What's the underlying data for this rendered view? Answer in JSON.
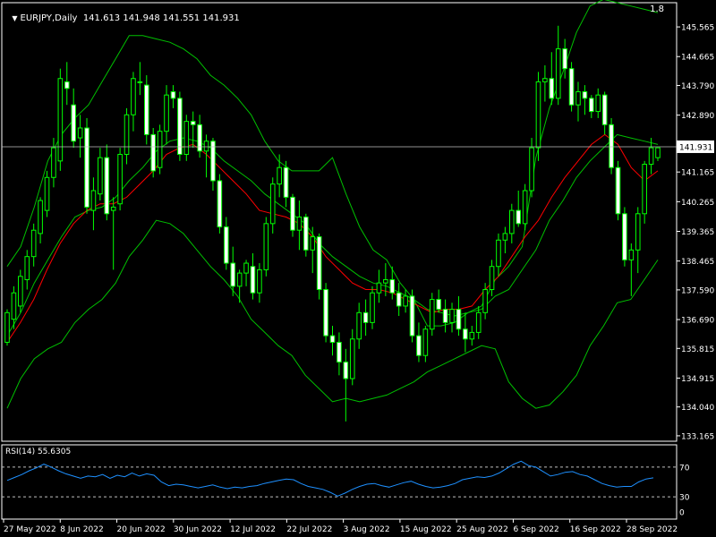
{
  "header": {
    "symbol_tf": "EURJPY,Daily",
    "ohlc": "141.613 141.948 141.551 141.931",
    "scale_number": "1.8"
  },
  "rsi": {
    "label": "RSI(14) 55.6305",
    "levels": [
      "70",
      "30",
      "0"
    ],
    "upper": 70,
    "lower": 30
  },
  "current_price": "141.931",
  "colors": {
    "background": "#000000",
    "bull_body": "#000000",
    "bear_body": "#ffffff",
    "candle_wick": "#00ff00",
    "bollinger": "#00c000",
    "ma": "#ff0000",
    "rsi": "#1e90ff",
    "axis": "#ffffff",
    "price_line": "#c0c0c0"
  },
  "chart_data": [
    {
      "type": "candlestick",
      "title": "EURJPY,Daily",
      "y_ticks": [
        "145.565",
        "144.665",
        "143.790",
        "142.890",
        "141.931",
        "141.165",
        "140.265",
        "139.365",
        "138.465",
        "137.590",
        "136.690",
        "135.815",
        "134.915",
        "134.040",
        "133.165"
      ],
      "x_ticks": [
        "27 May 2022",
        "8 Jun 2022",
        "20 Jun 2022",
        "30 Jun 2022",
        "12 Jul 2022",
        "22 Jul 2022",
        "3 Aug 2022",
        "15 Aug 2022",
        "25 Aug 2022",
        "6 Sep 2022",
        "16 Sep 2022",
        "28 Sep 2022"
      ],
      "ylim": [
        133.0,
        146.3
      ],
      "candles": [
        [
          136.0,
          137.0,
          135.9,
          136.9
        ],
        [
          136.7,
          137.7,
          136.4,
          137.5
        ],
        [
          137.1,
          138.2,
          136.9,
          138.0
        ],
        [
          137.9,
          138.8,
          137.6,
          138.6
        ],
        [
          138.6,
          139.6,
          138.3,
          139.4
        ],
        [
          139.3,
          140.4,
          139.0,
          140.3
        ],
        [
          140.0,
          141.2,
          139.8,
          141.0
        ],
        [
          141.0,
          142.2,
          140.7,
          141.9
        ],
        [
          141.5,
          144.3,
          141.2,
          144.0
        ],
        [
          143.9,
          144.5,
          143.2,
          143.7
        ],
        [
          143.2,
          143.7,
          141.9,
          142.1
        ],
        [
          142.2,
          142.9,
          141.6,
          142.5
        ],
        [
          142.5,
          142.8,
          139.9,
          140.1
        ],
        [
          140.0,
          141.0,
          139.4,
          140.6
        ],
        [
          140.5,
          141.9,
          140.3,
          141.6
        ],
        [
          141.6,
          142.0,
          139.7,
          139.9
        ],
        [
          140.0,
          140.4,
          138.2,
          140.1
        ],
        [
          140.2,
          141.9,
          140.0,
          141.7
        ],
        [
          141.7,
          143.1,
          141.4,
          142.9
        ],
        [
          142.9,
          144.2,
          142.4,
          144.0
        ],
        [
          143.9,
          144.5,
          143.5,
          143.9
        ],
        [
          143.8,
          144.1,
          142.0,
          142.3
        ],
        [
          142.3,
          142.5,
          141.0,
          141.2
        ],
        [
          141.3,
          142.6,
          141.1,
          142.4
        ],
        [
          142.4,
          143.8,
          142.0,
          143.5
        ],
        [
          143.6,
          143.8,
          143.1,
          143.4
        ],
        [
          143.4,
          143.6,
          141.5,
          141.7
        ],
        [
          141.7,
          142.9,
          141.5,
          142.7
        ],
        [
          142.7,
          143.0,
          141.9,
          142.6
        ],
        [
          142.6,
          142.9,
          141.6,
          141.8
        ],
        [
          141.8,
          142.3,
          141.0,
          142.1
        ],
        [
          142.1,
          142.2,
          140.6,
          140.9
        ],
        [
          140.9,
          141.1,
          139.3,
          139.5
        ],
        [
          139.5,
          139.8,
          138.2,
          138.4
        ],
        [
          138.4,
          138.9,
          137.4,
          137.7
        ],
        [
          137.7,
          138.2,
          137.2,
          138.1
        ],
        [
          138.1,
          138.5,
          137.7,
          138.4
        ],
        [
          138.3,
          138.7,
          137.3,
          137.5
        ],
        [
          137.5,
          138.4,
          137.2,
          138.2
        ],
        [
          138.2,
          139.8,
          138.0,
          139.6
        ],
        [
          139.6,
          141.0,
          139.3,
          140.8
        ],
        [
          140.8,
          141.7,
          140.4,
          141.3
        ],
        [
          141.3,
          141.5,
          140.1,
          140.4
        ],
        [
          140.4,
          140.5,
          139.2,
          139.4
        ],
        [
          139.4,
          140.3,
          138.8,
          139.8
        ],
        [
          139.8,
          139.9,
          138.6,
          138.8
        ],
        [
          138.8,
          139.5,
          138.1,
          139.2
        ],
        [
          139.2,
          139.3,
          137.3,
          137.6
        ],
        [
          137.6,
          137.8,
          136.0,
          136.2
        ],
        [
          136.2,
          136.5,
          135.6,
          136.0
        ],
        [
          136.0,
          136.3,
          135.0,
          135.4
        ],
        [
          135.4,
          135.8,
          133.6,
          134.9
        ],
        [
          134.9,
          136.4,
          134.7,
          136.1
        ],
        [
          136.1,
          137.2,
          135.8,
          136.9
        ],
        [
          136.9,
          137.3,
          136.2,
          136.6
        ],
        [
          136.6,
          137.7,
          136.4,
          137.5
        ],
        [
          137.5,
          138.2,
          137.2,
          137.8
        ],
        [
          137.8,
          138.4,
          137.4,
          137.9
        ],
        [
          137.9,
          138.3,
          137.3,
          137.5
        ],
        [
          137.5,
          137.8,
          136.8,
          137.1
        ],
        [
          137.1,
          137.6,
          136.9,
          137.4
        ],
        [
          137.4,
          137.6,
          136.0,
          136.2
        ],
        [
          136.2,
          136.6,
          135.4,
          135.6
        ],
        [
          135.6,
          136.5,
          135.4,
          136.4
        ],
        [
          136.4,
          137.5,
          136.2,
          137.3
        ],
        [
          137.3,
          137.6,
          136.9,
          137.0
        ],
        [
          137.0,
          137.3,
          136.3,
          136.6
        ],
        [
          136.6,
          137.2,
          136.3,
          137.0
        ],
        [
          137.0,
          137.4,
          136.2,
          136.4
        ],
        [
          136.4,
          136.9,
          135.7,
          136.1
        ],
        [
          136.1,
          136.5,
          135.9,
          136.3
        ],
        [
          136.3,
          137.1,
          136.1,
          136.9
        ],
        [
          136.9,
          137.8,
          136.7,
          137.6
        ],
        [
          137.6,
          138.5,
          137.4,
          138.3
        ],
        [
          138.3,
          139.3,
          138.0,
          139.1
        ],
        [
          139.1,
          139.5,
          138.7,
          139.3
        ],
        [
          139.3,
          140.2,
          139.0,
          140.0
        ],
        [
          140.0,
          140.6,
          139.5,
          139.6
        ],
        [
          139.6,
          140.8,
          139.4,
          140.6
        ],
        [
          140.6,
          142.2,
          140.4,
          141.9
        ],
        [
          141.9,
          144.2,
          141.5,
          143.9
        ],
        [
          143.9,
          144.4,
          143.3,
          144.0
        ],
        [
          144.0,
          144.8,
          143.2,
          143.4
        ],
        [
          143.4,
          145.6,
          143.2,
          144.9
        ],
        [
          144.9,
          145.2,
          144.0,
          144.3
        ],
        [
          144.3,
          144.5,
          143.0,
          143.2
        ],
        [
          143.2,
          143.9,
          142.7,
          143.6
        ],
        [
          143.6,
          143.8,
          142.9,
          143.4
        ],
        [
          143.4,
          143.5,
          142.8,
          143.0
        ],
        [
          143.0,
          143.7,
          142.8,
          143.5
        ],
        [
          143.5,
          143.6,
          142.3,
          142.6
        ],
        [
          142.6,
          142.8,
          141.1,
          141.3
        ],
        [
          141.3,
          141.5,
          139.7,
          139.9
        ],
        [
          139.9,
          140.1,
          138.3,
          138.5
        ],
        [
          138.5,
          139.0,
          137.4,
          138.8
        ],
        [
          138.8,
          140.1,
          138.1,
          139.9
        ],
        [
          139.9,
          141.5,
          139.6,
          141.4
        ],
        [
          141.4,
          142.2,
          141.1,
          141.9
        ],
        [
          141.6,
          141.9,
          141.5,
          141.9
        ]
      ],
      "bb_upper": [
        138.3,
        138.9,
        140.1,
        141.5,
        142.3,
        142.8,
        143.2,
        143.9,
        144.6,
        145.3,
        145.3,
        145.2,
        145.1,
        144.9,
        144.6,
        144.1,
        143.8,
        143.4,
        142.9,
        142.1,
        141.5,
        141.2,
        141.2,
        141.2,
        141.6,
        140.5,
        139.5,
        138.8,
        138.5,
        137.8,
        137.3,
        136.5,
        136.5,
        136.6,
        136.9,
        137.1,
        137.9,
        138.3,
        138.9,
        141.6,
        143.1,
        144.2,
        145.4,
        146.2,
        146.4,
        146.3,
        146.2,
        146.1,
        146.0
      ],
      "bb_mid": [
        136.2,
        136.9,
        137.8,
        138.5,
        139.2,
        139.8,
        140.0,
        140.1,
        140.4,
        140.9,
        141.3,
        141.8,
        142.1,
        142.2,
        142.1,
        141.9,
        141.5,
        141.2,
        140.9,
        140.5,
        140.2,
        139.9,
        139.6,
        139.0,
        138.6,
        138.3,
        138.0,
        137.8,
        137.7,
        137.5,
        137.3,
        137.0,
        136.9,
        136.8,
        136.9,
        137.0,
        137.4,
        137.6,
        138.2,
        138.8,
        139.7,
        140.3,
        141.0,
        141.5,
        141.9,
        142.3,
        142.2,
        142.1,
        142.0
      ],
      "bb_lower": [
        134.0,
        134.9,
        135.5,
        135.8,
        136.0,
        136.6,
        137.0,
        137.3,
        137.8,
        138.6,
        139.1,
        139.7,
        139.6,
        139.3,
        138.8,
        138.3,
        137.9,
        137.4,
        136.7,
        136.3,
        135.9,
        135.6,
        135.0,
        134.6,
        134.2,
        134.3,
        134.2,
        134.3,
        134.4,
        134.6,
        134.8,
        135.1,
        135.3,
        135.5,
        135.7,
        135.9,
        135.8,
        134.8,
        134.3,
        134.0,
        134.1,
        134.5,
        135.0,
        135.9,
        136.5,
        137.2,
        137.3,
        137.9,
        138.5
      ],
      "ma": [
        136.0,
        136.6,
        137.3,
        138.2,
        139.0,
        139.6,
        140.0,
        140.2,
        140.2,
        140.4,
        140.8,
        141.2,
        141.7,
        141.9,
        142.0,
        141.7,
        141.3,
        140.9,
        140.5,
        140.0,
        139.9,
        139.8,
        139.6,
        139.2,
        138.6,
        138.2,
        137.8,
        137.6,
        137.6,
        137.5,
        137.3,
        137.1,
        136.9,
        137.0,
        137.0,
        137.1,
        137.6,
        138.0,
        138.6,
        139.2,
        139.7,
        140.4,
        141.0,
        141.5,
        142.0,
        142.3,
        142.0,
        141.3,
        140.9,
        141.2
      ]
    },
    {
      "type": "line",
      "title": "RSI(14) 55.6305",
      "y_ticks": [
        "70",
        "30",
        "0"
      ],
      "ylim": [
        0,
        100
      ],
      "values": [
        52,
        56,
        60,
        65,
        69,
        74,
        70,
        65,
        61,
        58,
        55,
        58,
        57,
        60,
        55,
        59,
        57,
        62,
        58,
        61,
        59,
        50,
        45,
        47,
        46,
        44,
        42,
        44,
        46,
        43,
        41,
        43,
        42,
        44,
        45,
        48,
        50,
        52,
        54,
        53,
        48,
        44,
        42,
        40,
        36,
        31,
        35,
        40,
        44,
        47,
        48,
        45,
        43,
        46,
        49,
        51,
        47,
        44,
        42,
        43,
        45,
        48,
        53,
        55,
        57,
        56,
        58,
        62,
        68,
        74,
        78,
        72,
        70,
        64,
        58,
        60,
        63,
        64,
        60,
        58,
        53,
        48,
        45,
        43,
        44,
        44,
        50,
        54,
        55.6
      ]
    }
  ]
}
